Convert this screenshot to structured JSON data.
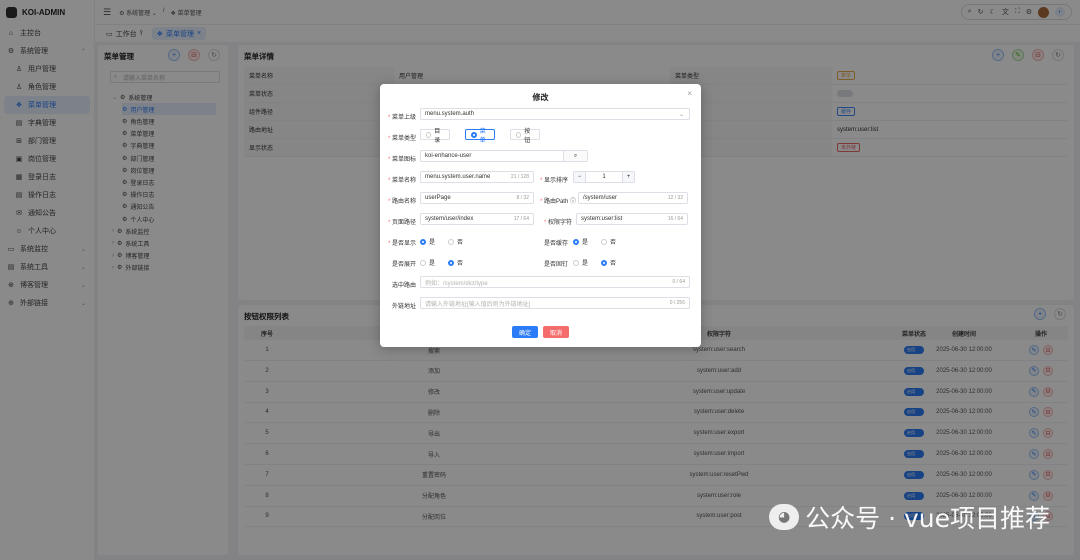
{
  "app": {
    "title": "KOI-ADMIN"
  },
  "sidebar": {
    "items": [
      {
        "icon": "home-icon",
        "glyph": "⌂",
        "label": "主控台"
      },
      {
        "icon": "gear-icon",
        "glyph": "⚙",
        "label": "系统管理"
      },
      {
        "icon": "user-icon",
        "glyph": "♙",
        "label": "用户管理"
      },
      {
        "icon": "role-icon",
        "glyph": "♙",
        "label": "角色管理"
      },
      {
        "icon": "menu-icon",
        "glyph": "❖",
        "label": "菜单管理"
      },
      {
        "icon": "dict-icon",
        "glyph": "▤",
        "label": "字典管理"
      },
      {
        "icon": "dept-icon",
        "glyph": "⊞",
        "label": "部门管理"
      },
      {
        "icon": "post-icon",
        "glyph": "▣",
        "label": "岗位管理"
      },
      {
        "icon": "login-log-icon",
        "glyph": "▦",
        "label": "登录日志"
      },
      {
        "icon": "op-log-icon",
        "glyph": "▤",
        "label": "操作日志"
      },
      {
        "icon": "notice-icon",
        "glyph": "✉",
        "label": "通知公告"
      },
      {
        "icon": "personal-icon",
        "glyph": "☺",
        "label": "个人中心"
      },
      {
        "icon": "monitor-icon",
        "glyph": "▭",
        "label": "系统监控"
      },
      {
        "icon": "tools-icon",
        "glyph": "▤",
        "label": "系统工具"
      },
      {
        "icon": "blog-icon",
        "glyph": "⊕",
        "label": "博客管理"
      },
      {
        "icon": "link-icon",
        "glyph": "⊕",
        "label": "外部链接"
      }
    ]
  },
  "header": {
    "breadcrumb": [
      "系统管理",
      "菜单管理"
    ]
  },
  "tabs": [
    "工作台",
    "菜单管理"
  ],
  "menu_panel": {
    "title": "菜单管理",
    "search_placeholder": "请输入菜单名称",
    "tree": [
      {
        "label": "系统管理",
        "level": 0
      },
      {
        "label": "用户管理",
        "level": 1,
        "active": true
      },
      {
        "label": "角色管理",
        "level": 1
      },
      {
        "label": "菜单管理",
        "level": 1
      },
      {
        "label": "字典管理",
        "level": 1
      },
      {
        "label": "部门管理",
        "level": 1
      },
      {
        "label": "岗位管理",
        "level": 1
      },
      {
        "label": "登录日志",
        "level": 1
      },
      {
        "label": "操作日志",
        "level": 1
      },
      {
        "label": "通知公告",
        "level": 1
      },
      {
        "label": "个人中心",
        "level": 1
      },
      {
        "label": "系统监控",
        "level": 0
      },
      {
        "label": "系统工具",
        "level": 0
      },
      {
        "label": "博客管理",
        "level": 0
      },
      {
        "label": "外部链接",
        "level": 0
      }
    ]
  },
  "detail": {
    "title": "菜单详情",
    "rows": [
      {
        "k1": "菜单名称",
        "v1": "用户管理",
        "k2": "菜单类型",
        "v2": "菜单",
        "v2color": "#e6a23c"
      },
      {
        "k1": "菜单状态",
        "v1": "",
        "k2": "",
        "v2": "",
        "v2color": ""
      },
      {
        "k1": "组件路径",
        "v1": "",
        "k2": "",
        "v2": "缓存",
        "v2color": "#2b7cf6"
      },
      {
        "k1": "路由地址",
        "v1": "",
        "k2": "",
        "v2": "system:user:list",
        "v2color": "#333"
      },
      {
        "k1": "显示状态",
        "v1": "",
        "k2": "",
        "v2": "未外链",
        "v2color": "#e45656"
      }
    ]
  },
  "perm": {
    "title": "按钮权限列表",
    "headers": [
      "序号",
      "权限字符",
      "菜单状态",
      "创建时间",
      "操作"
    ],
    "rows": [
      {
        "no": "1",
        "name": "搜索",
        "perm": "system:user:search",
        "status": "启用",
        "time": "2025-06-30 12:00:00"
      },
      {
        "no": "2",
        "name": "添加",
        "perm": "system:user:add",
        "status": "启用",
        "time": "2025-06-30 12:00:00"
      },
      {
        "no": "3",
        "name": "修改",
        "perm": "system:user:update",
        "status": "启用",
        "time": "2025-06-30 12:00:00"
      },
      {
        "no": "4",
        "name": "删除",
        "perm": "system:user:delete",
        "status": "启用",
        "time": "2025-06-30 12:00:00"
      },
      {
        "no": "5",
        "name": "导出",
        "perm": "system:user:export",
        "status": "启用",
        "time": "2025-06-30 12:00:00"
      },
      {
        "no": "6",
        "name": "导入",
        "perm": "system:user:import",
        "status": "启用",
        "time": "2025-06-30 12:00:00"
      },
      {
        "no": "7",
        "name": "重置密码",
        "perm": "system:user:resetPwd",
        "status": "启用",
        "time": "2025-06-30 12:00:00"
      },
      {
        "no": "8",
        "name": "分配角色",
        "perm": "system:user:role",
        "status": "启用",
        "time": "2025-06-30 12:00:00"
      },
      {
        "no": "9",
        "name": "分配岗位",
        "perm": "system:user:post",
        "status": "启用",
        "time": "2025-06-30 12:00:00"
      }
    ]
  },
  "modal": {
    "title": "修改",
    "parent_label": "菜单上级",
    "parent_value": "menu.system.auth",
    "type_label": "菜单类型",
    "type_options": [
      "目录",
      "菜单",
      "按钮"
    ],
    "icon_label": "菜单图标",
    "icon_value": "koi-enhance-user",
    "name_label": "菜单名称",
    "name_value": "menu.system.user.name",
    "name_count": "21 / 128",
    "sort_label": "显示排序",
    "sort_value": "1",
    "route_name_label": "路由名称",
    "route_name_value": "userPage",
    "route_name_count": "8 / 32",
    "route_path_label": "路由Path",
    "route_path_value": "/system/user",
    "route_path_count": "12 / 32",
    "component_label": "页面路径",
    "component_value": "system/user/index",
    "component_count": "17 / 64",
    "perm_label": "权限字符",
    "perm_value": "system:user:list",
    "perm_count": "16 / 64",
    "show_label": "是否显示",
    "cache_label": "是否缓存",
    "expand_label": "是否展开",
    "affix_label": "是否固钉",
    "yes": "是",
    "no": "否",
    "active_label": "选中路由",
    "active_placeholder": "例如：/system/dict/type",
    "active_count": "0 / 64",
    "link_label": "外链地址",
    "link_placeholder": "请输入外链地址[输入值后则为外链地址]",
    "link_count": "0 / 256",
    "confirm": "确定",
    "cancel": "取消"
  },
  "watermark": {
    "text": "公众号 · vue项目推荐"
  },
  "colors": {
    "primary": "#2b7cf6",
    "danger": "#f56c6c"
  }
}
